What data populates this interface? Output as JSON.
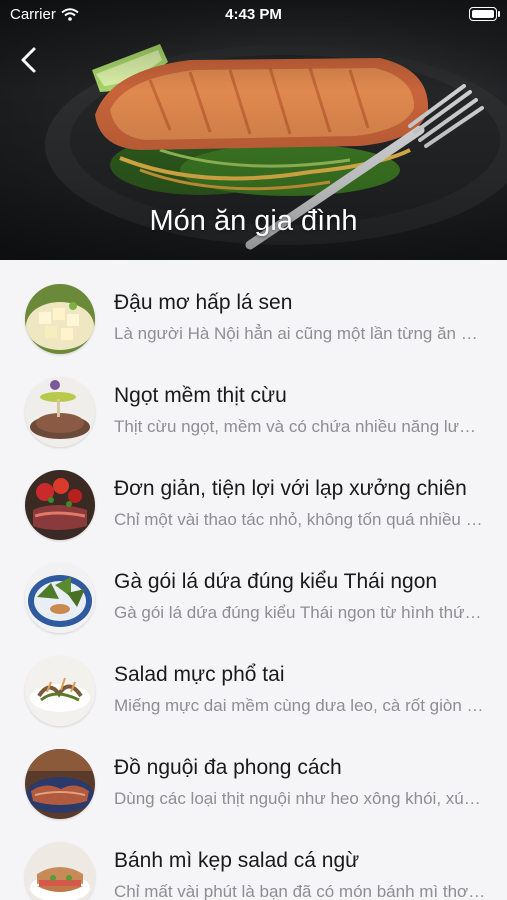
{
  "status_bar": {
    "carrier": "Carrier",
    "time": "4:43 PM",
    "icons": [
      "wifi-icon",
      "battery-icon"
    ]
  },
  "header": {
    "title": "Món ăn gia đình",
    "back_icon": "chevron-left-icon"
  },
  "items": [
    {
      "title": "Đậu mơ hấp lá sen",
      "description": "Là người Hà Nội hẳn ai cũng một lần từng ăn qua món đậu mơ"
    },
    {
      "title": "Ngọt mềm thịt cừu",
      "description": "Thịt cừu ngọt, mềm và có chứa nhiều năng lượng"
    },
    {
      "title": "Đơn giản, tiện lợi với lạp xưởng chiên",
      "description": "Chỉ một vài thao tác nhỏ, không tốn quá nhiều thời gian"
    },
    {
      "title": "Gà gói lá dứa đúng kiểu Thái ngon",
      "description": "Gà gói lá dứa đúng kiểu Thái ngon từ hình thức đến hương vị"
    },
    {
      "title": "Salad mực phổ tai",
      "description": "Miếng mực dai mềm cùng dưa leo, cà rốt giòn ngọt"
    },
    {
      "title": "Đồ nguội đa phong cách",
      "description": "Dùng các loại thịt nguội như heo xông khói, xúc xích"
    },
    {
      "title": "Bánh mì kẹp salad cá ngừ",
      "description": "Chỉ mất vài phút là bạn đã có món bánh mì thơm ngon"
    }
  ]
}
